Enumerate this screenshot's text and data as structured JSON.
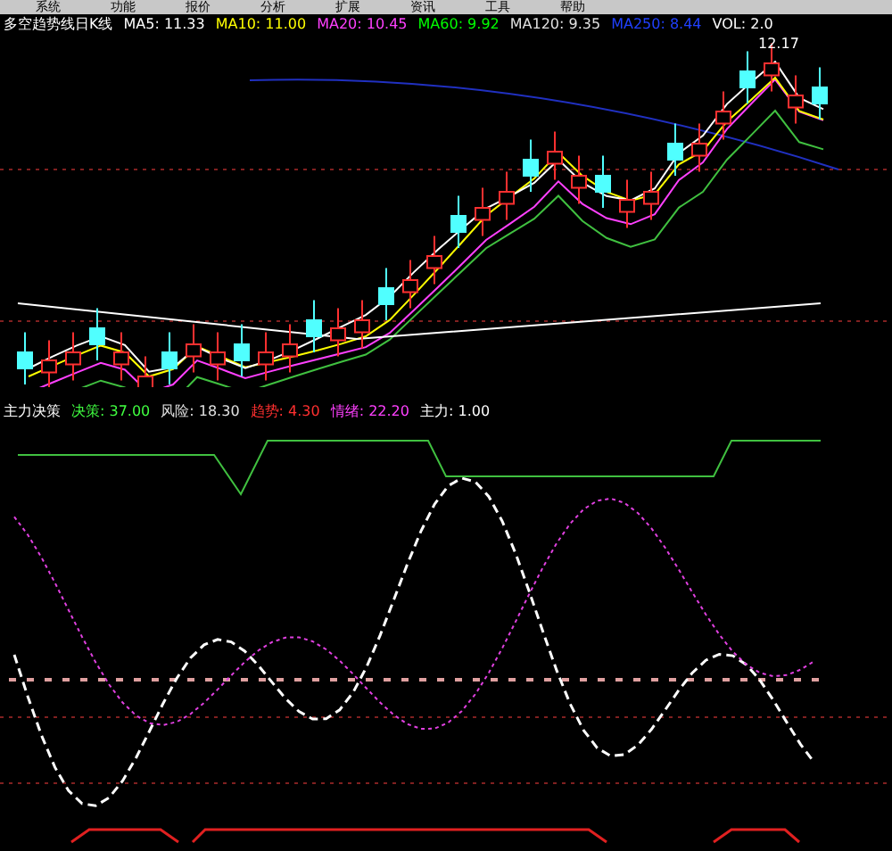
{
  "menu": [
    "系统",
    "功能",
    "报价",
    "分析",
    "扩展",
    "资讯",
    "工具",
    "帮助"
  ],
  "title": "多空趋势线日K线",
  "ma_legend": [
    {
      "text": "MA5: 11.33",
      "color": "#ffffff"
    },
    {
      "text": "MA10: 11.00",
      "color": "#ffff00"
    },
    {
      "text": "MA20: 10.45",
      "color": "#ff40ff"
    },
    {
      "text": "MA60: 9.92",
      "color": "#00ff00"
    },
    {
      "text": "MA120: 9.35",
      "color": "#e0e0e0"
    },
    {
      "text": "MA250: 8.44",
      "color": "#2040ff"
    },
    {
      "text": "VOL: 2.0",
      "color": "#ffffff"
    }
  ],
  "price_label": "12.17",
  "indicator": {
    "name": "主力决策",
    "items": [
      {
        "text": "决策: 37.00",
        "color": "#40ff40"
      },
      {
        "text": "风险: 18.30",
        "color": "#e0e0e0"
      },
      {
        "text": "趋势: 4.30",
        "color": "#ff3030"
      },
      {
        "text": "情绪: 22.20",
        "color": "#ff40ff"
      },
      {
        "text": "主力: 1.00",
        "color": "#ffffff"
      }
    ]
  }
}
